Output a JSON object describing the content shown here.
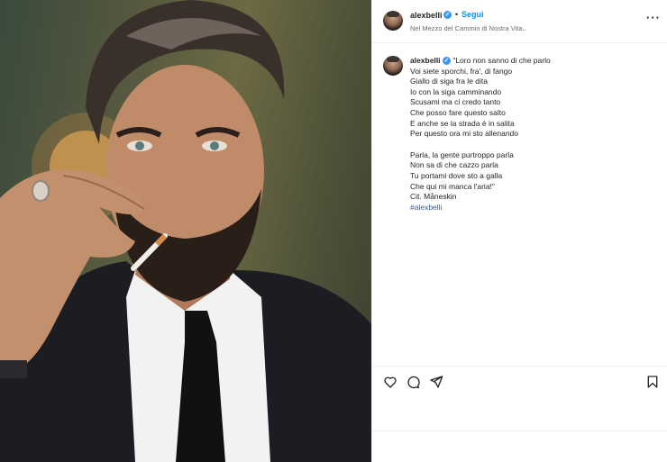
{
  "post": {
    "username": "alexbelli",
    "verified_icon": "verified-badge-icon",
    "separator": "•",
    "follow_label": "Segui",
    "location": "Nel Mezzo del Cammin di Nostra Vita..",
    "more_label": "···"
  },
  "caption": {
    "username": "alexbelli",
    "lines": [
      "\"Loro non sanno di che parlo",
      "Voi siete sporchi, fra', di fango",
      "Giallo di siga fra le dita",
      "Io con la siga camminando",
      "Scusami ma ci credo tanto",
      "Che posso fare questo salto",
      "E anche se la strada è in salita",
      "Per questo ora mi sto allenando",
      "",
      "Parla, la gente purtroppo parla",
      "Non sa di che cazzo parla",
      "Tu portami dove sto a galla",
      "Che qui mi manca l'aria!\"",
      "Cit. Måneskin"
    ],
    "hashtag": "#alexbelli"
  },
  "actions": {
    "like_icon": "heart-icon",
    "comment_icon": "comment-icon",
    "share_icon": "send-icon",
    "save_icon": "bookmark-icon"
  },
  "colors": {
    "follow_blue": "#0095f6",
    "verified_blue": "#3897f0",
    "hashtag": "#385898",
    "border": "#efefef"
  }
}
